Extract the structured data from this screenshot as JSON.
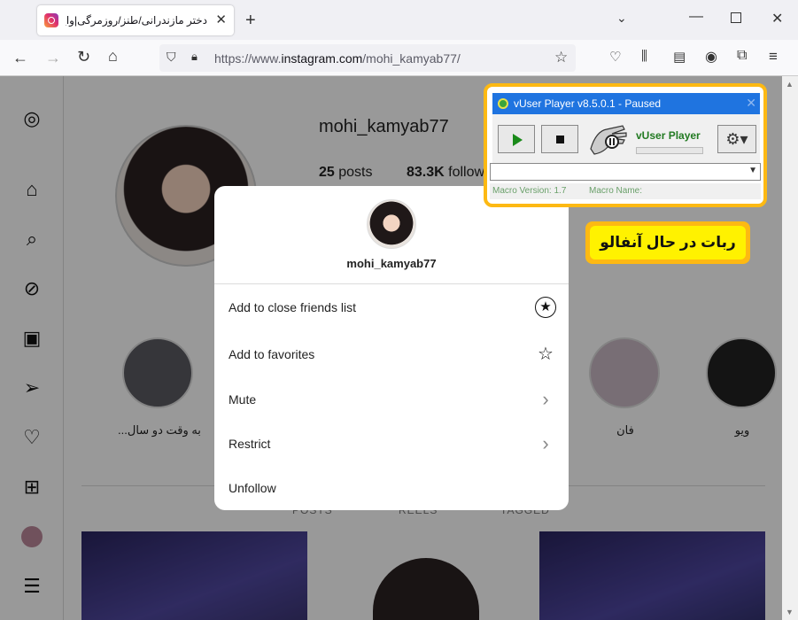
{
  "browser": {
    "tab_title": "دختر مازندرانی/طنز/روزمرگی|واینر",
    "new_tab": "+",
    "url_prefix": "https://www.",
    "url_domain": "instagram.com",
    "url_path": "/mohi_kamyab77/"
  },
  "profile": {
    "username": "mohi_kamyab77",
    "posts_count": "25",
    "posts_label": "posts",
    "followers_count": "83.3K",
    "followers_label": "followers"
  },
  "highlights": [
    {
      "label": "به وقت دو سال..."
    },
    {
      "label": "فان"
    },
    {
      "label": "ویو"
    }
  ],
  "tabs": [
    "POSTS",
    "REELS",
    "TAGGED"
  ],
  "modal": {
    "username": "mohi_kamyab77",
    "items": [
      {
        "label": "Add to close friends list",
        "icon": "close-friends-star-icon"
      },
      {
        "label": "Add to favorites",
        "icon": "star-outline-icon"
      },
      {
        "label": "Mute",
        "icon": "chevron-right-icon"
      },
      {
        "label": "Restrict",
        "icon": "chevron-right-icon"
      },
      {
        "label": "Unfollow",
        "icon": ""
      }
    ]
  },
  "vuser": {
    "title": "vUser Player v8.5.0.1 - Paused",
    "brand": "vUser Player",
    "macro_version_label": "Macro Version: 1.7",
    "macro_name_label": "Macro Name:",
    "accent_color": "#1f74e0"
  },
  "annotation": {
    "text": "ربات در حال آنفالو"
  },
  "colors": {
    "frame": "#fdb913",
    "callout": "#fff200"
  }
}
